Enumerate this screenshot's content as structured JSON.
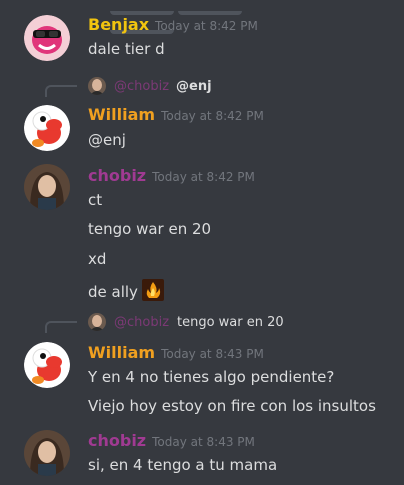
{
  "messages": [
    {
      "author": "Benjax",
      "timestamp": "Today at 8:42 PM",
      "lines": [
        "dale tier d"
      ]
    },
    {
      "reply": {
        "author": "@chobiz",
        "text": "@enj"
      },
      "author": "William",
      "timestamp": "Today at 8:42 PM",
      "lines": [
        "@enj"
      ]
    },
    {
      "author": "chobiz",
      "timestamp": "Today at 8:42 PM",
      "lines": [
        "ct",
        "tengo war en 20",
        "xd",
        "de ally"
      ]
    },
    {
      "reply": {
        "author": "@chobiz",
        "text": "tengo war en 20"
      },
      "author": "William",
      "timestamp": "Today at 8:43 PM",
      "lines": [
        "Y en 4 no tienes algo pendiente?",
        "Viejo hoy estoy on fire con los insultos"
      ]
    },
    {
      "author": "chobiz",
      "timestamp": "Today at 8:43 PM",
      "lines": [
        "si, en 4 tengo a tu mama"
      ]
    }
  ],
  "colors": {
    "background": "#36393f",
    "benjax": "#f1c40f",
    "william": "#f0a020",
    "chobiz": "#a03a92",
    "timestamp": "#72767d",
    "text": "#dcddde"
  }
}
